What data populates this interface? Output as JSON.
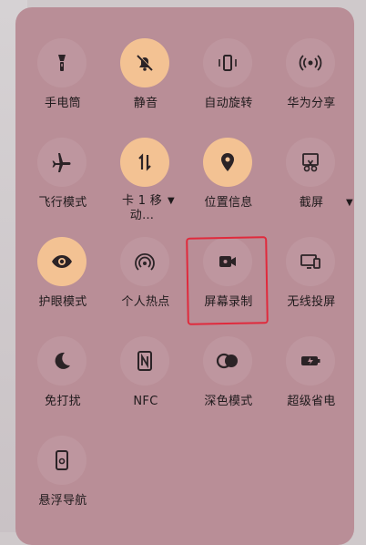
{
  "tiles": [
    {
      "label": "手电筒",
      "icon": "flashlight-icon",
      "active": false
    },
    {
      "label": "静音",
      "icon": "bell-mute-icon",
      "active": true
    },
    {
      "label": "自动旋转",
      "icon": "auto-rotate-icon",
      "active": false
    },
    {
      "label": "华为分享",
      "icon": "share-waves-icon",
      "active": false
    },
    {
      "label": "飞行模式",
      "icon": "airplane-icon",
      "active": false
    },
    {
      "label": "卡 1 移动…",
      "icon": "mobile-data-icon",
      "active": true
    },
    {
      "label": "位置信息",
      "icon": "location-pin-icon",
      "active": true
    },
    {
      "label": "截屏",
      "icon": "screenshot-scissors-icon",
      "active": false
    },
    {
      "label": "护眼模式",
      "icon": "eye-icon",
      "active": true
    },
    {
      "label": "个人热点",
      "icon": "hotspot-icon",
      "active": false
    },
    {
      "label": "屏幕录制",
      "icon": "screen-record-icon",
      "active": false
    },
    {
      "label": "无线投屏",
      "icon": "wireless-projection-icon",
      "active": false
    },
    {
      "label": "免打扰",
      "icon": "moon-icon",
      "active": false
    },
    {
      "label": "NFC",
      "icon": "nfc-icon",
      "active": false
    },
    {
      "label": "深色模式",
      "icon": "dark-mode-icon",
      "active": false
    },
    {
      "label": "超级省电",
      "icon": "battery-saver-icon",
      "active": false
    },
    {
      "label": "悬浮导航",
      "icon": "floating-nav-icon",
      "active": false
    }
  ],
  "colors": {
    "panel": "#b98e97",
    "active": "#f3c293",
    "highlight": "#e02a3c"
  }
}
